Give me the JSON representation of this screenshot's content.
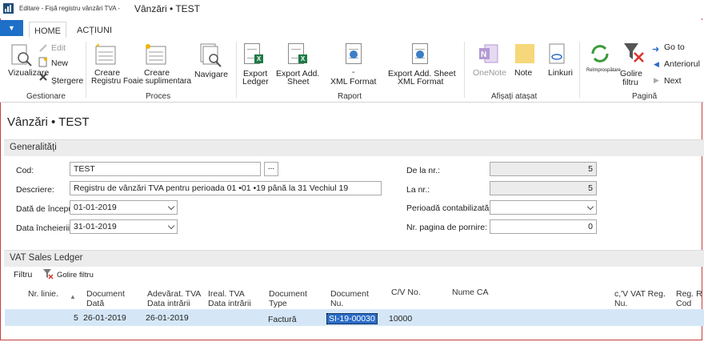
{
  "window": {
    "small_title": "Editare - Fișă registru vânzări TVA -",
    "title": "Vânzări • TEST"
  },
  "ribbon": {
    "app_menu_label": "▼",
    "tabs": [
      {
        "label": "HOME"
      },
      {
        "label": "ACȚIUNI"
      }
    ],
    "buttons": {
      "vizualizare": "Vizualizare",
      "edit": "Edit",
      "new": "New",
      "stergere": "Ștergere",
      "creare1": "Creare",
      "creare2": "Creare",
      "registru": "Registru",
      "foaie": "Foaie suplimentara",
      "navigare": "Navigare",
      "export_ledger_1": "Export",
      "export_ledger_2": "Ledger",
      "export_add_1": "Export Add.",
      "export_add_2": "Sheet",
      "dash": "-",
      "xml_format": "XML Format",
      "export_add_xml_1": "Export Add. Sheet",
      "export_add_xml_2": "XML Format",
      "onenote": "OneNote",
      "note": "Note",
      "linkuri": "Linkuri",
      "reimprospatare": "Reîmprospătare",
      "golire_filtru_1": "Golire",
      "golire_filtru_2": "filtru",
      "go_to": "Go to",
      "anterior": "Anteriorul",
      "next": "Next"
    },
    "groups": {
      "gestionare": "Gestionare",
      "proces": "Proces",
      "raport": "Raport",
      "afisati": "Afișați atașat",
      "pagina": "Pagină"
    }
  },
  "page": {
    "title": "Vânzări • TEST"
  },
  "general": {
    "header": "Generalități",
    "cod_label": "Cod:",
    "cod_value": "TEST",
    "lookup_label": "...",
    "descriere_label": "Descriere:",
    "descriere_value": "Registru de vânzări TVA pentru perioada 01 •01 •19 până la 31 Vechiul 19",
    "data_inceput_label": "Dată de început:",
    "data_inceput_value": "01-01-2019",
    "data_incheierii_label": "Data încheierii:",
    "data_incheierii_value": "31-01-2019",
    "de_la_label": "De la nr.:",
    "de_la_value": "5",
    "la_label": "La nr.:",
    "la_value": "5",
    "perioada_label": "Perioadă contabilizată:",
    "perioada_value": "",
    "pagina_label": "Nr. pagina de pornire:",
    "pagina_value": "0"
  },
  "ledger": {
    "header": "VAT Sales Ledger",
    "filter_label": "Filtru",
    "clear_filter_label": "Golire filtru",
    "columns": {
      "line_no": "Nr. linie.",
      "doc_date_1": "Document",
      "doc_date_2": "Dată",
      "vat_date_1": "Adevărat. TVA",
      "vat_date_2": "Data intrării",
      "real_vat_1": "Ireal. TVA",
      "real_vat_2": "Data intrării",
      "doc_type_1": "Document",
      "doc_type_2": "Type",
      "doc_no_1": "Document",
      "doc_no_2": "Nu.",
      "cv_no": "C/V No.",
      "name": "Nume CA",
      "vat_reg_1": "c,'V VAT Reg.",
      "vat_reg_2": "Nu.",
      "reg_code_1": "Reg. R",
      "reg_code_2": "Cod"
    },
    "rows": [
      {
        "line_no": "5",
        "doc_date": "26-01-2019",
        "vat_date": "26-01-2019",
        "doc_type": "Factură",
        "doc_no": "SI-19-00030",
        "cv_no": "10000"
      }
    ]
  }
}
